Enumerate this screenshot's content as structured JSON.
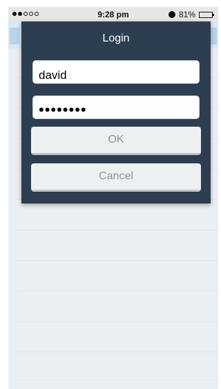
{
  "status_bar": {
    "signal_filled": 2,
    "signal_total": 5,
    "time": "9:28 pm",
    "alarm_icon": "alarm-icon",
    "battery_percent": "81%",
    "battery_level": 0.81
  },
  "dialog": {
    "title": "Login",
    "username_value": "david",
    "password_value": "********",
    "ok_label": "OK",
    "cancel_label": "Cancel"
  },
  "colors": {
    "dialog_bg": "#2c3e50",
    "button_bg": "#ecf0f1",
    "app_bg": "#eceff1",
    "header_bg": "#d8e8f4"
  }
}
